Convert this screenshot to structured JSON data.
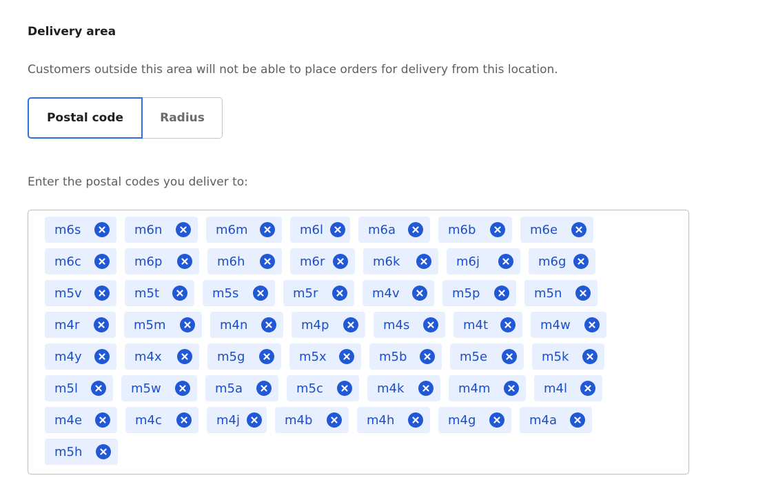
{
  "delivery": {
    "title": "Delivery area",
    "description": "Customers outside this area will not be able to place orders for delivery from this location.",
    "tabs": [
      {
        "label": "Postal code",
        "active": true
      },
      {
        "label": "Radius",
        "active": false
      }
    ],
    "prompt": "Enter the postal codes you deliver to:",
    "remove_icon": "close-circle-icon",
    "chip_color": "#1c4fc7",
    "chip_background": "#e8efff",
    "accent_color": "#2b6fe0",
    "postal_codes": [
      [
        "m6s",
        "m6n",
        "m6m",
        "m6l",
        "m6a",
        "m6b",
        "m6e"
      ],
      [
        "m6c",
        "m6p",
        "m6h",
        "m6r",
        "m6k",
        "m6j",
        "m6g"
      ],
      [
        "m5v",
        "m5t",
        "m5s",
        "m5r",
        "m4v",
        "m5p",
        "m5n"
      ],
      [
        "m4r",
        "m5m",
        "m4n",
        "m4p",
        "m4s",
        "m4t",
        "m4w"
      ],
      [
        "m4y",
        "m4x",
        "m5g",
        "m5x",
        "m5b",
        "m5e",
        "m5k"
      ],
      [
        "m5l",
        "m5w",
        "m5a",
        "m5c",
        "m4k",
        "m4m",
        "m4l"
      ],
      [
        "m4e",
        "m4c",
        "m4j",
        "m4b",
        "m4h",
        "m4g",
        "m4a"
      ],
      [
        "m5h"
      ]
    ]
  }
}
